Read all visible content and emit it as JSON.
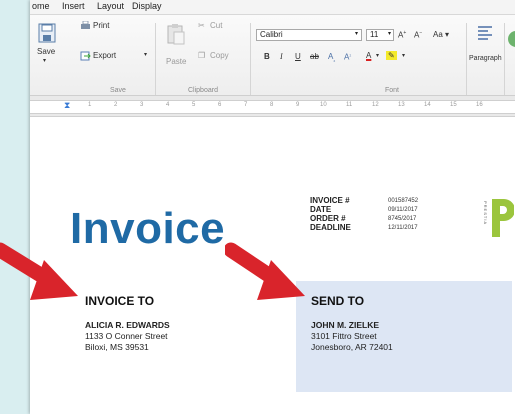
{
  "menu": {
    "items": [
      "ome",
      "Insert",
      "Layout",
      "Display"
    ]
  },
  "ribbon": {
    "save": "Save",
    "print": "Print",
    "export": "Export",
    "paste": "Paste",
    "cut": "Cut",
    "copy": "Copy",
    "font_name": "Calibri",
    "font_size": "11",
    "paragraph": "Paragraph",
    "groups": [
      "Save",
      "Clipboard",
      "Font"
    ]
  },
  "ruler": {
    "numbers": [
      "1",
      "2",
      "3",
      "4",
      "5",
      "6",
      "7",
      "8",
      "9",
      "10",
      "11",
      "12",
      "13",
      "14",
      "15",
      "16"
    ]
  },
  "document": {
    "title": "Invoice",
    "meta": [
      {
        "label": "INVOICE #",
        "value": "001587452"
      },
      {
        "label": "DATE",
        "value": "09/11/2017"
      },
      {
        "label": "ORDER #",
        "value": "8745/2017"
      },
      {
        "label": "DEADLINE",
        "value": "12/11/2017"
      }
    ],
    "logo_text": "PRESTIA",
    "invoice_to": {
      "heading": "INVOICE TO",
      "name": "ALICIA R. EDWARDS",
      "street": "1133 O Conner Street",
      "city": "Biloxi, MS 39531"
    },
    "send_to": {
      "heading": "SEND TO",
      "name": "JOHN M. ZIELKE",
      "street": "3101 Fittro Street",
      "city": "Jonesboro, AR 72401"
    }
  },
  "colors": {
    "title_blue": "#1f6aa5",
    "arrow_red": "#d9242b",
    "logo_green": "#9bc53d",
    "sendto_bg": "#dde6f4"
  }
}
